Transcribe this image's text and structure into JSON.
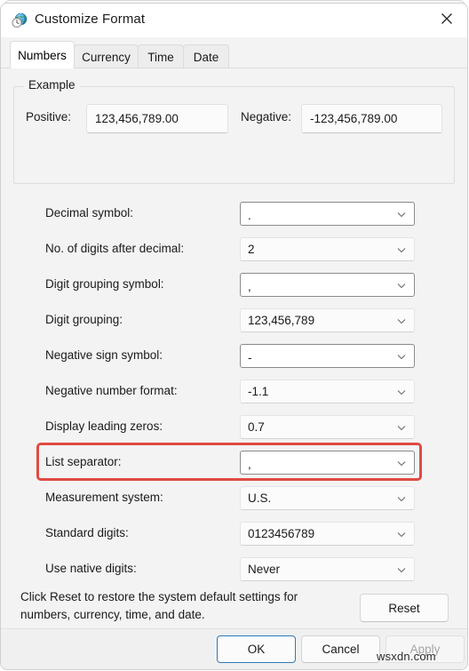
{
  "window": {
    "title": "Customize Format",
    "icon": "region-globe-clock-icon",
    "close_label": "✕"
  },
  "tabs": [
    {
      "label": "Numbers",
      "active": true
    },
    {
      "label": "Currency",
      "active": false
    },
    {
      "label": "Time",
      "active": false
    },
    {
      "label": "Date",
      "active": false
    }
  ],
  "example": {
    "legend": "Example",
    "positive_label": "Positive:",
    "positive_value": "123,456,789.00",
    "negative_label": "Negative:",
    "negative_value": "-123,456,789.00"
  },
  "settings": [
    {
      "label": "Decimal symbol:",
      "value": ".",
      "editable": true,
      "highlighted": false
    },
    {
      "label": "No. of digits after decimal:",
      "value": "2",
      "editable": false,
      "highlighted": false
    },
    {
      "label": "Digit grouping symbol:",
      "value": ",",
      "editable": true,
      "highlighted": false
    },
    {
      "label": "Digit grouping:",
      "value": "123,456,789",
      "editable": false,
      "highlighted": false
    },
    {
      "label": "Negative sign symbol:",
      "value": "-",
      "editable": true,
      "highlighted": false
    },
    {
      "label": "Negative number format:",
      "value": "-1.1",
      "editable": false,
      "highlighted": false
    },
    {
      "label": "Display leading zeros:",
      "value": "0.7",
      "editable": false,
      "highlighted": false
    },
    {
      "label": "List separator:",
      "value": ",",
      "editable": true,
      "highlighted": true
    },
    {
      "label": "Measurement system:",
      "value": "U.S.",
      "editable": false,
      "highlighted": false
    },
    {
      "label": "Standard digits:",
      "value": "0123456789",
      "editable": false,
      "highlighted": false
    },
    {
      "label": "Use native digits:",
      "value": "Never",
      "editable": false,
      "highlighted": false
    }
  ],
  "reset": {
    "description": "Click Reset to restore the system default settings for numbers, currency, time, and date.",
    "button_label": "Reset"
  },
  "footer": {
    "ok_label": "OK",
    "cancel_label": "Cancel",
    "apply_label": "Apply",
    "apply_disabled": true
  },
  "watermark": "wsxdn.com",
  "colors": {
    "highlight": "#e04a43",
    "default_button_border": "#3079b9",
    "dialog_background": "#f3f3f3",
    "titlebar_background": "#ffffff"
  }
}
